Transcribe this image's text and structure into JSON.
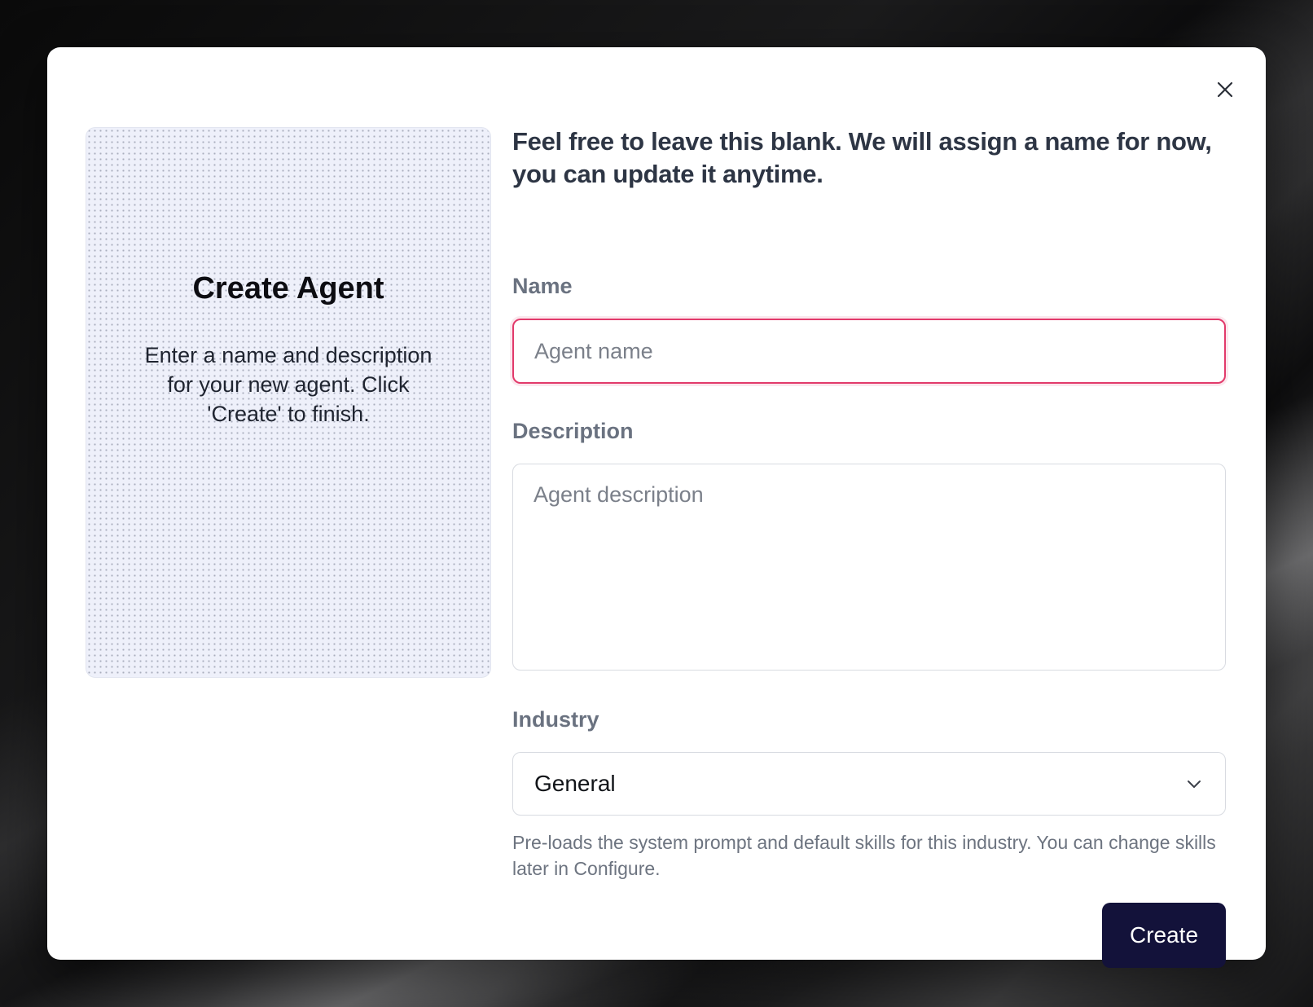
{
  "modal": {
    "close_icon": "close-icon"
  },
  "left_panel": {
    "title": "Create Agent",
    "subtitle": "Enter a name and description for your new agent. Click 'Create' to finish."
  },
  "form": {
    "headline": "Feel free to leave this blank. We will assign a name for now, you can update it anytime.",
    "name": {
      "label": "Name",
      "value": "",
      "placeholder": "Agent name"
    },
    "description": {
      "label": "Description",
      "value": "",
      "placeholder": "Agent description"
    },
    "industry": {
      "label": "Industry",
      "selected": "General",
      "icon": "chevron-down-icon",
      "hint": "Pre-loads the system prompt and default skills for this industry. You can change skills later in Configure."
    },
    "create_label": "Create"
  },
  "colors": {
    "focus_border": "#e23a6b",
    "primary_button": "#13123a",
    "panel_bg": "#eef0fa"
  }
}
